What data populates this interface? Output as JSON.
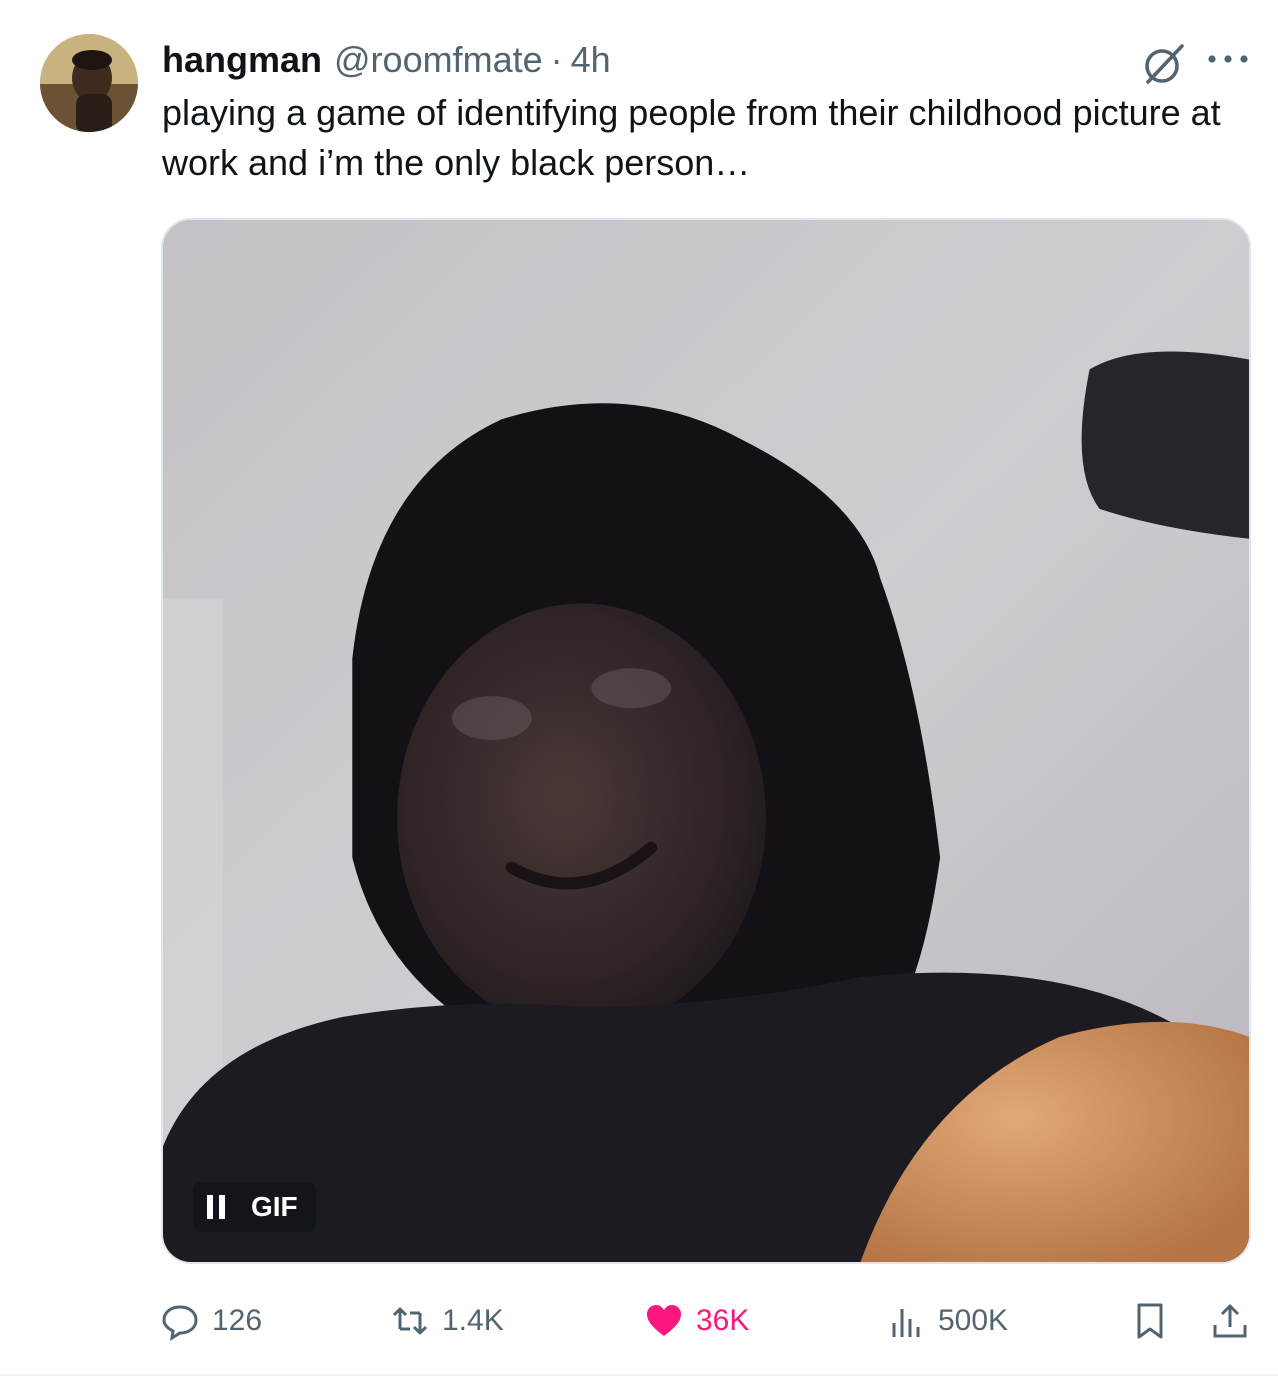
{
  "author": {
    "display_name": "hangman",
    "handle": "@roomfmate",
    "separator": "·",
    "time": "4h"
  },
  "tweet": {
    "text": "playing a game of identifying people from their childhood picture at work and i’m the only black person…"
  },
  "media": {
    "badge_label": "GIF",
    "badge_icon": "pause-icon"
  },
  "actions": {
    "replies": "126",
    "reposts": "1.4K",
    "likes": "36K",
    "views": "500K"
  },
  "colors": {
    "text_primary": "#0f1419",
    "text_secondary": "#536471",
    "like_active": "#f91880",
    "border": "#e1e6ea"
  },
  "icons": {
    "header": [
      "grok-icon",
      "more-icon"
    ],
    "actions": [
      "reply-icon",
      "repost-icon",
      "heart-icon",
      "views-icon",
      "bookmark-icon",
      "share-icon"
    ]
  }
}
